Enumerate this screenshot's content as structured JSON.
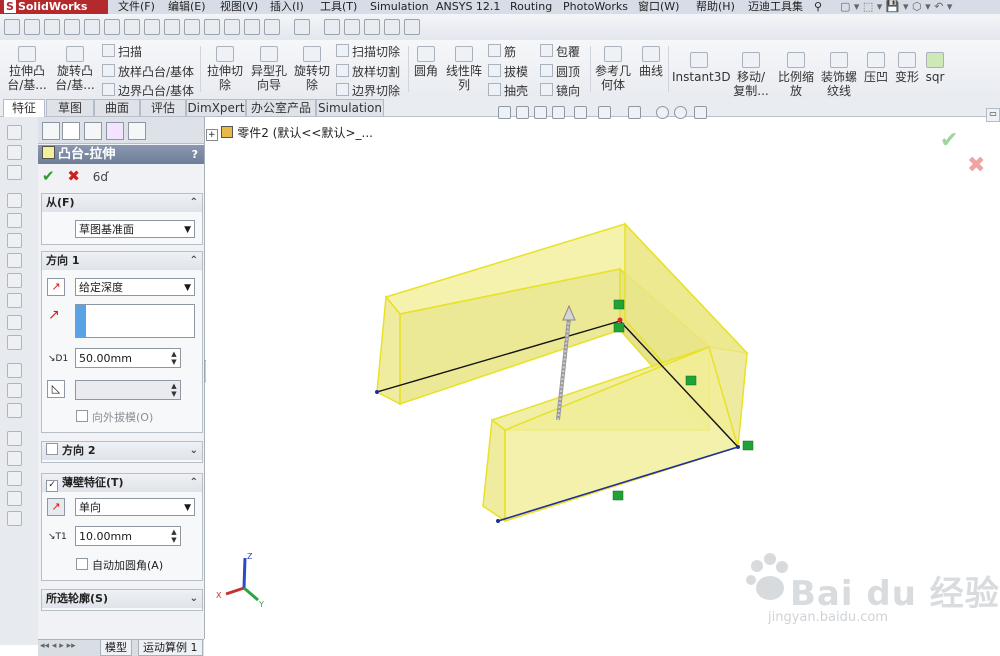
{
  "app": {
    "logo_text": "SolidWorks"
  },
  "menu": [
    {
      "label": "文件(F)"
    },
    {
      "label": "编辑(E)"
    },
    {
      "label": "视图(V)"
    },
    {
      "label": "插入(I)"
    },
    {
      "label": "工具(T)"
    },
    {
      "label": "Simulation"
    },
    {
      "label": "ANSYS 12.1"
    },
    {
      "label": "Routing"
    },
    {
      "label": "PhotoWorks"
    },
    {
      "label": "窗口(W)"
    },
    {
      "label": "帮助(H)"
    },
    {
      "label": "迈迪工具集"
    }
  ],
  "ribbon": {
    "extrude_boss": "拉伸凸\n台/基...",
    "revolve_boss": "旋转凸\n台/基...",
    "sweep": "扫描",
    "loft_boss": "放样凸台/基体",
    "boundary_boss": "边界凸台/基体",
    "extrude_cut": "拉伸切\n除",
    "hole_wizard": "异型孔\n向导",
    "revolve_cut": "旋转切\n除",
    "sweep_cut": "扫描切除",
    "loft_cut": "放样切割",
    "boundary_cut": "边界切除",
    "fillet": "圆角",
    "linear_pattern": "线性阵\n列",
    "rib": "筋",
    "draft": "拔模",
    "shell": "抽壳",
    "wrap": "包覆",
    "dome": "圆顶",
    "mirror": "镜向",
    "ref_geometry": "参考几\n何体",
    "curves": "曲线",
    "instant3d": "Instant3D",
    "move_copy": "移动/\n复制...",
    "scale": "比例缩\n放",
    "cosmetic_thread": "装饰螺\n纹线",
    "indent": "压凹",
    "deform": "变形",
    "sqr": "sqr"
  },
  "tabs": [
    {
      "label": "特征",
      "active": true
    },
    {
      "label": "草图"
    },
    {
      "label": "曲面"
    },
    {
      "label": "评估"
    },
    {
      "label": "DimXpert"
    },
    {
      "label": "办公室产品"
    },
    {
      "label": "Simulation"
    }
  ],
  "property_manager": {
    "title": "凸台-拉伸",
    "from": {
      "header": "从(F)",
      "value": "草图基准面"
    },
    "direction1": {
      "header": "方向 1",
      "end_condition": "给定深度",
      "depth": "50.00mm",
      "draft_outward_label": "向外拔模(O)"
    },
    "direction2": {
      "header": "方向 2"
    },
    "thin_feature": {
      "header": "薄壁特征(T)",
      "type": "单向",
      "thickness": "10.00mm",
      "auto_fillet_label": "自动加圆角(A)"
    },
    "selected_contours": {
      "header": "所选轮廓(S)"
    },
    "help_label": "?"
  },
  "bottom_tabs": [
    {
      "label": "模型"
    },
    {
      "label": "运动算例 1"
    }
  ],
  "graphics": {
    "tree_label": "零件2 (默认<<默认>_...",
    "triad": {
      "x": "X",
      "y": "Y",
      "z": "Z"
    },
    "colors": {
      "preview_fill": "#f3ef9a",
      "preview_edge": "#e8e226",
      "sketch_line_black": "#111111",
      "sketch_line_blue": "#1f2f9c",
      "relation_green": "#21a236"
    }
  },
  "watermark": {
    "brand": "Bai du 经验",
    "url": "jingyan.baidu.com"
  }
}
